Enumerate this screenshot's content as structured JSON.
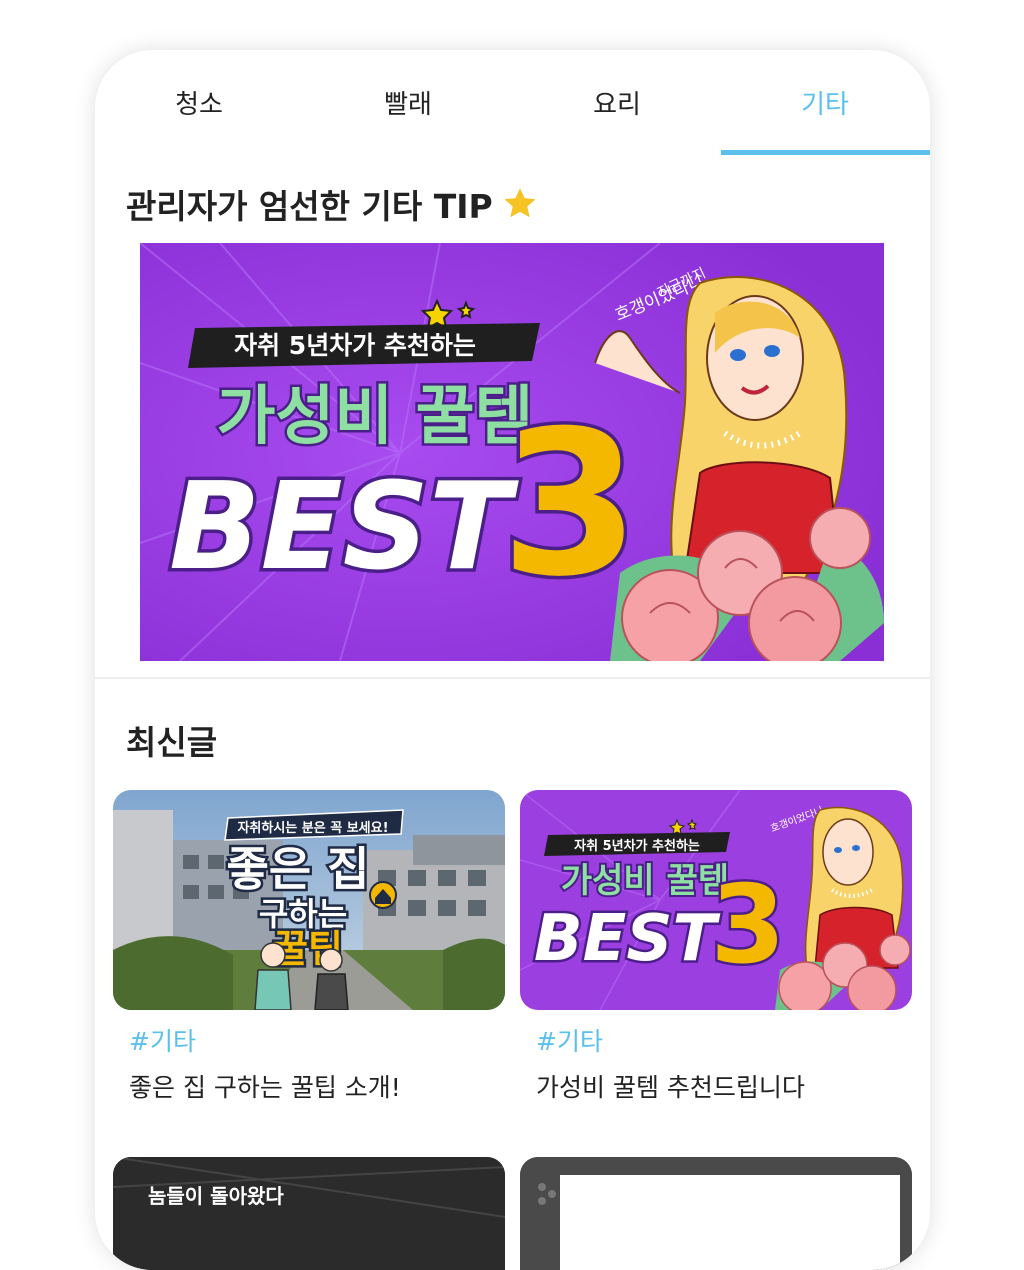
{
  "tabs": [
    {
      "label": "청소"
    },
    {
      "label": "빨래"
    },
    {
      "label": "요리"
    },
    {
      "label": "기타"
    }
  ],
  "active_tab_color": "#5bc0eb",
  "featured": {
    "title": "관리자가 엄선한 기타 TIP",
    "title_icon": "star-icon",
    "banner": {
      "ribbon": "자취 5년차가 추천하는",
      "headline": "가성비 꿀템",
      "big": "BEST",
      "number": "3",
      "handwriting_line1": "지금까지",
      "handwriting_line2": "호갱이었다니"
    }
  },
  "latest": {
    "title": "최신글",
    "posts": [
      {
        "tag": "#기타",
        "title": "좋은 집 구하는 꿀팁 소개!",
        "thumb_top": "자취하시는 분은 꼭 보세요!",
        "thumb_line1": "좋은 집",
        "thumb_line2": "구하는",
        "thumb_line3": "꿀팁"
      },
      {
        "tag": "#기타",
        "title": "가성비 꿀템 추천드립니다",
        "thumb_ribbon": "자취 5년차가 추천하는",
        "thumb_headline": "가성비 꿀템",
        "thumb_big": "BEST",
        "thumb_number": "3",
        "thumb_hand": "호갱이었다니"
      }
    ],
    "more_preview_text": "놈들이 돌아왔다"
  },
  "colors": {
    "banner_purple": "#9c3fe0",
    "mint_text": "#8ee0a2",
    "gold": "#f5b800"
  }
}
